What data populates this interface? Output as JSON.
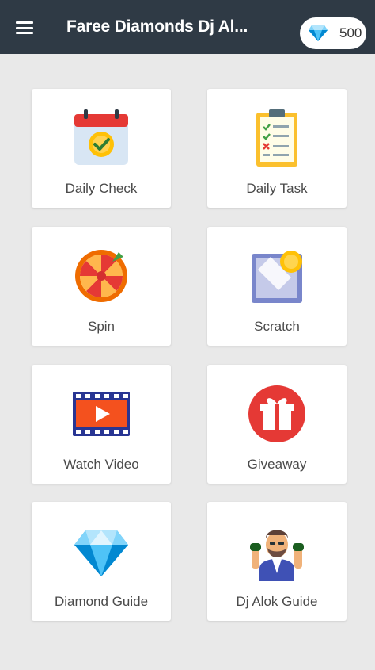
{
  "appbar": {
    "title": "Faree Diamonds Dj Al...",
    "menu_icon": "hamburger-menu-icon",
    "balance": {
      "icon": "diamond-icon",
      "value": "500"
    }
  },
  "grid": {
    "items": [
      {
        "label": "Daily Check",
        "icon": "calendar-check-icon"
      },
      {
        "label": "Daily Task",
        "icon": "clipboard-checklist-icon"
      },
      {
        "label": "Spin",
        "icon": "spin-wheel-icon"
      },
      {
        "label": "Scratch",
        "icon": "scratch-card-icon"
      },
      {
        "label": "Watch Video",
        "icon": "video-play-icon"
      },
      {
        "label": "Giveaway",
        "icon": "gift-icon"
      },
      {
        "label": "Diamond Guide",
        "icon": "diamond-icon"
      },
      {
        "label": "Dj Alok Guide",
        "icon": "dj-alok-avatar-icon"
      }
    ]
  },
  "colors": {
    "appbar": "#2f3a45",
    "background": "#e9e9e9",
    "card": "#ffffff"
  }
}
